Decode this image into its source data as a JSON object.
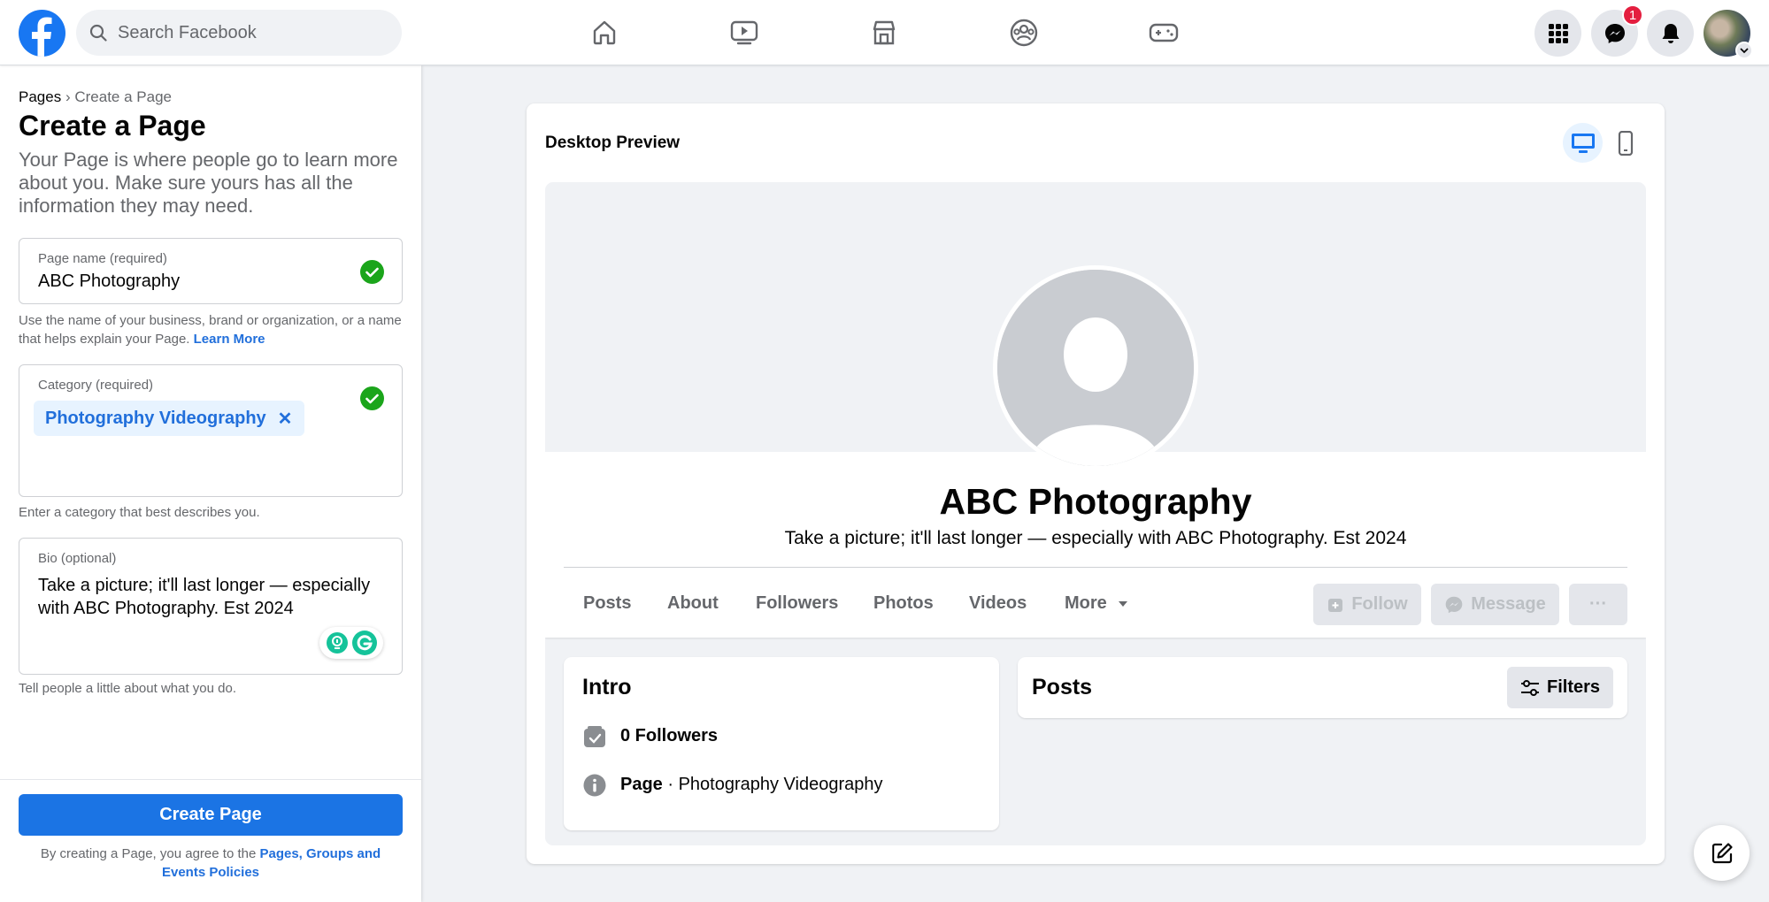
{
  "header": {
    "search_placeholder": "Search Facebook",
    "messenger_badge": "1",
    "nav_icons": [
      "home-icon",
      "watch-icon",
      "marketplace-icon",
      "groups-icon",
      "gaming-icon"
    ]
  },
  "breadcrumb": {
    "root": "Pages",
    "separator": "›",
    "current": "Create a Page"
  },
  "form": {
    "title": "Create a Page",
    "subtitle": "Your Page is where people go to learn more about you. Make sure yours has all the information they may need.",
    "page_name": {
      "label": "Page name (required)",
      "value": "ABC Photography",
      "helper": "Use the name of your business, brand or organization, or a name that helps explain your Page.",
      "learn_more": "Learn More"
    },
    "category": {
      "label": "Category (required)",
      "chip": "Photography Videography",
      "chip_remove": "✕",
      "helper": "Enter a category that best describes you."
    },
    "bio": {
      "label": "Bio (optional)",
      "value": "Take a picture; it'll last longer — especially with ABC Photography. Est 2024",
      "helper": "Tell people a little about what you do."
    },
    "create_button": "Create Page",
    "terms_prefix": "By creating a Page, you agree to the",
    "terms_link": "Pages, Groups and Events Policies"
  },
  "preview": {
    "title": "Desktop Preview",
    "page_name": "ABC Photography",
    "bio": "Take a picture; it'll last longer — especially with ABC Photography. Est 2024",
    "tabs": [
      "Posts",
      "About",
      "Followers",
      "Photos",
      "Videos",
      "More"
    ],
    "actions": {
      "follow": "Follow",
      "message": "Message",
      "more": "···"
    },
    "intro": {
      "title": "Intro",
      "followers": "0 Followers",
      "page_label": "Page",
      "category": " · Photography Videography"
    },
    "posts": {
      "title": "Posts",
      "filters": "Filters"
    }
  },
  "colors": {
    "brand": "#1877f2",
    "link": "#216fdb",
    "success": "#1ba51b",
    "badge": "#e41e3f"
  }
}
